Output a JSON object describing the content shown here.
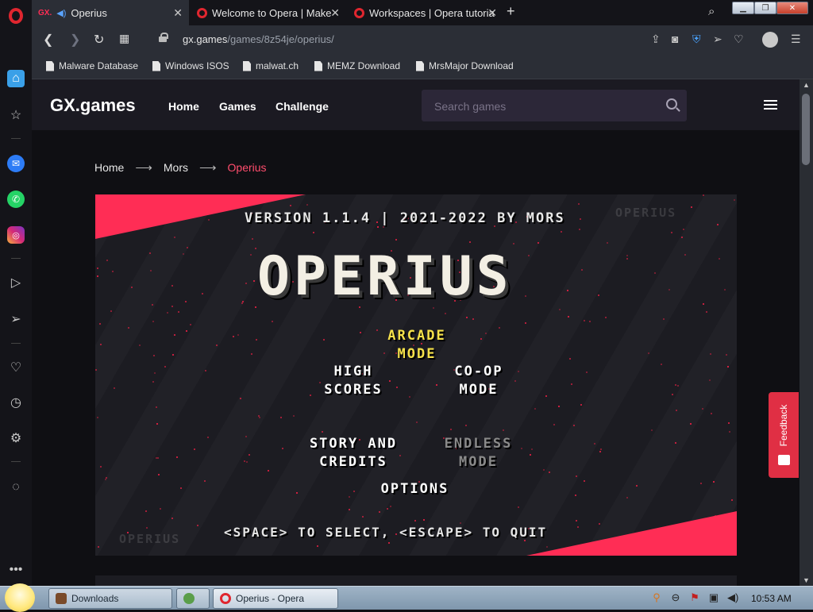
{
  "browser": {
    "tabs": [
      {
        "title": "Operius",
        "active": true
      },
      {
        "title": "Welcome to Opera | Make",
        "active": false
      },
      {
        "title": "Workspaces | Opera tutoria",
        "active": false
      }
    ],
    "url_domain": "gx.games",
    "url_path": "/games/8z54je/operius/",
    "bookmarks": [
      "Malware Database",
      "Windows ISOS",
      "malwat.ch",
      "MEMZ Download",
      "MrsMajor Download"
    ]
  },
  "site": {
    "logo": "GX.games",
    "nav": [
      "Home",
      "Games",
      "Challenge"
    ],
    "search_placeholder": "Search games",
    "breadcrumb": {
      "home": "Home",
      "creator": "Mors",
      "current": "Operius",
      "separator": "⟶"
    }
  },
  "game": {
    "version_line": "VERSION 1.1.4 | 2021-2022 BY MORS",
    "title": "OPERIUS",
    "menu": {
      "arcade": [
        "ARCADE",
        "MODE"
      ],
      "high_scores": [
        "HIGH",
        "SCORES"
      ],
      "coop": [
        "CO-OP",
        "MODE"
      ],
      "story": [
        "STORY AND",
        "CREDITS"
      ],
      "endless": [
        "ENDLESS",
        "MODE"
      ],
      "options": "OPTIONS"
    },
    "hint": "<SPACE> TO SELECT, <ESCAPE> TO QUIT",
    "ghost_text": "OPERIUS"
  },
  "feedback_label": "Feedback",
  "taskbar": {
    "downloads": "Downloads",
    "opera_window": "Operius - Opera",
    "clock": "10:53 AM"
  },
  "colors": {
    "accent": "#ff2d55",
    "breadcrumb_current": "#ff4d6d",
    "menu_selected": "#f5e14a",
    "menu_disabled": "#8a8a8a"
  }
}
